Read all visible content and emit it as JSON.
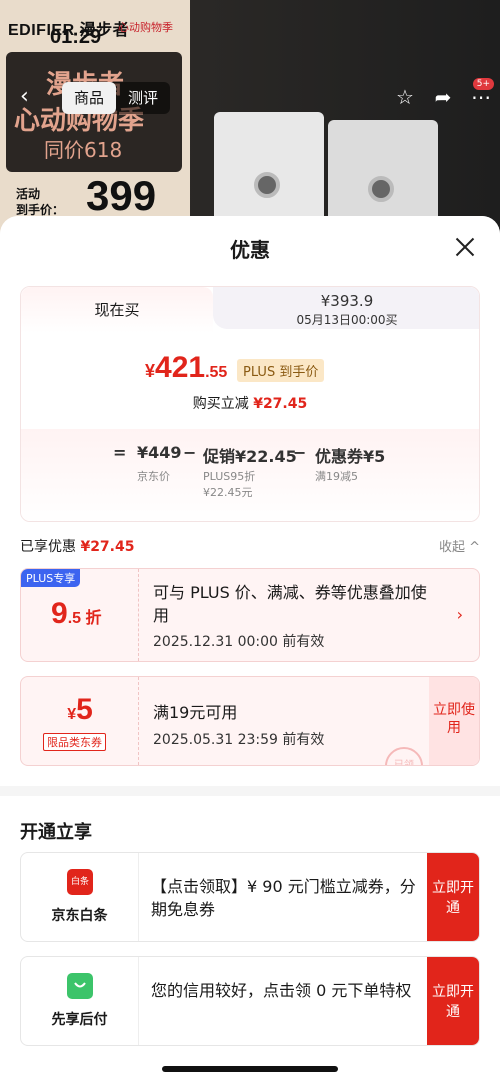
{
  "background": {
    "brand": "EDIFIER 漫步者",
    "brand_tag": "心动购物季",
    "clock": "01:29",
    "banner_line1": "漫步者",
    "banner_line2": "心动购物季",
    "banner_line3": "同价618",
    "activity_label_1": "活动",
    "activity_label_2": "到手价：",
    "activity_price": "399",
    "tabs": [
      "商品",
      "测评"
    ],
    "cart_badge": "5+"
  },
  "sheet": {
    "title": "优惠"
  },
  "price_card": {
    "tab_now": "现在买",
    "tab_later_price": "¥393.9",
    "tab_later_time": "05月13日00:00买",
    "price_yen": "¥",
    "price_int": "421",
    "price_dec": ".55",
    "plus_tag": "PLUS 到手价",
    "reduce_label": "购买立减",
    "reduce_value": "¥27.45",
    "formula": {
      "eq": "=",
      "jd_price": "¥449",
      "minus1": "−",
      "promo": "促销¥22.45",
      "minus2": "−",
      "coupon": "优惠券¥5",
      "jd_price_label": "京东价",
      "promo_sub1": "PLUS95折",
      "promo_sub2": "¥22.45元",
      "coupon_sub": "满19减5"
    }
  },
  "saved": {
    "label": "已享优惠",
    "value": "¥27.45",
    "collapse": "收起 ^"
  },
  "coupon1": {
    "badge": "PLUS专享",
    "disc_big": "9",
    "disc_small": ".5 折",
    "text": "可与 PLUS 价、满减、券等优惠叠加使用",
    "date": "2025.12.31 00:00 前有效",
    "arrow": "›"
  },
  "coupon2": {
    "yen": "¥",
    "amount": "5",
    "tag": "限品类东券",
    "text": "满19元可用",
    "date": "2025.05.31 23:59 前有效",
    "button": "立即使用",
    "stamp": "已领"
  },
  "open": {
    "title": "开通立享",
    "services": [
      {
        "name": "京东白条",
        "icon_text": "白条",
        "text": "【点击领取】¥ 90 元门槛立减券，分期免息券",
        "button": "立即开通"
      },
      {
        "name": "先享后付",
        "icon_text": "",
        "text": "您的信用较好，点击领 0 元下单特权",
        "button": "立即开通"
      }
    ]
  },
  "colors": {
    "accent_red": "#e1251b",
    "plus_blue": "#3d64f0",
    "plus_gold": "#fbe7c6",
    "paylater_green": "#3cc46a"
  }
}
